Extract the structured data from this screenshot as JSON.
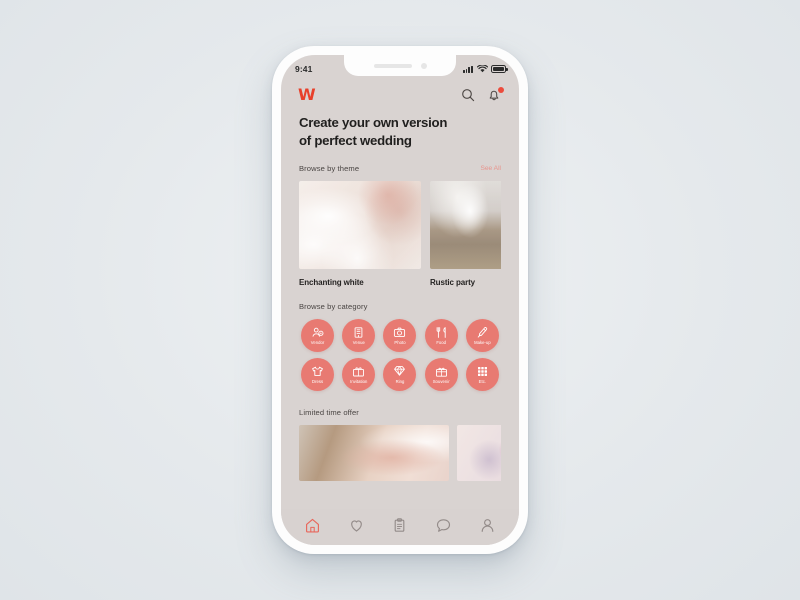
{
  "background": {
    "canvas_color": "#e8ecef",
    "device_body_color": "#fdfdfd",
    "screen_color": "#d9d3d1"
  },
  "status_bar": {
    "time": "9:41",
    "signal_icon": "signal-bars-icon",
    "wifi_icon": "wifi-icon",
    "battery_icon": "battery-full-icon"
  },
  "header": {
    "logo_text": "W",
    "logo_color": "#e8402a",
    "search_icon": "search-icon",
    "notification_icon": "bell-icon",
    "badge_count": "",
    "badge_color": "#ec4b3c"
  },
  "hero": {
    "line1": "Create your own version",
    "line2": "of perfect wedding"
  },
  "theme_section": {
    "title": "Browse by theme",
    "see_all_label": "See All",
    "see_all_color": "#e8948d",
    "cards": [
      {
        "label": "Enchanting white",
        "image": "bride-lace-dress-photo"
      },
      {
        "label": "Rustic party",
        "image": "bridal-shoes-on-wood-photo"
      }
    ]
  },
  "category_section": {
    "title": "Browse by category",
    "circle_color": "#e87a72",
    "items": [
      {
        "label": "Vendor",
        "icon": "user-badge-icon"
      },
      {
        "label": "Venue",
        "icon": "building-icon"
      },
      {
        "label": "Photo",
        "icon": "camera-icon"
      },
      {
        "label": "Food",
        "icon": "fork-knife-icon"
      },
      {
        "label": "Make-up",
        "icon": "makeup-brush-icon"
      },
      {
        "label": "Dress",
        "icon": "tshirt-icon"
      },
      {
        "label": "Invitation",
        "icon": "envelope-ribbon-icon"
      },
      {
        "label": "Ring",
        "icon": "diamond-ring-icon"
      },
      {
        "label": "Souvenir",
        "icon": "gift-box-icon"
      },
      {
        "label": "Etc.",
        "icon": "grid-dots-icon"
      }
    ]
  },
  "offer_section": {
    "title": "Limited time offer",
    "thumbs": [
      {
        "image": "couple-celebration-photo"
      },
      {
        "image": "floral-arrangement-photo"
      }
    ]
  },
  "bottom_nav": {
    "active_index": 0,
    "active_color": "#e8675c",
    "inactive_color": "#948c8a",
    "items": [
      {
        "name": "home",
        "icon": "home-icon"
      },
      {
        "name": "favorites",
        "icon": "heart-icon"
      },
      {
        "name": "planner",
        "icon": "clipboard-icon"
      },
      {
        "name": "messages",
        "icon": "chat-bubble-icon"
      },
      {
        "name": "profile",
        "icon": "person-icon"
      }
    ]
  }
}
